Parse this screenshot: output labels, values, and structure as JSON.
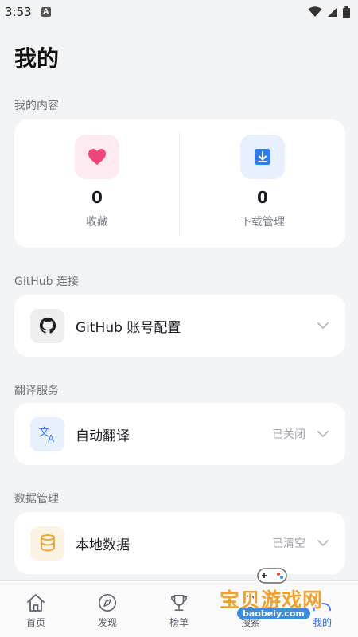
{
  "status_bar": {
    "time": "3:53",
    "notification_icon": "a-icon",
    "wifi_icon": "wifi-icon",
    "signal_icon": "signal-icon",
    "battery_icon": "battery-icon"
  },
  "header": {
    "title": "我的"
  },
  "my_content": {
    "section_label": "我的内容",
    "favorites": {
      "count": "0",
      "label": "收藏",
      "icon": "heart-icon",
      "accent": "#f0457a"
    },
    "downloads": {
      "count": "0",
      "label": "下载管理",
      "icon": "download-icon",
      "accent": "#2f7cf0"
    }
  },
  "github": {
    "section_label": "GitHub 连接",
    "row_title": "GitHub 账号配置",
    "icon": "github-icon"
  },
  "translation": {
    "section_label": "翻译服务",
    "row_title": "自动翻译",
    "status": "已关闭",
    "icon": "translate-icon"
  },
  "data_management": {
    "section_label": "数据管理",
    "row_title": "本地数据",
    "status": "已清空",
    "icon": "database-icon"
  },
  "bottom_nav": {
    "items": [
      {
        "label": "首页",
        "icon": "home-icon"
      },
      {
        "label": "发现",
        "icon": "compass-icon"
      },
      {
        "label": "榜单",
        "icon": "trophy-icon"
      },
      {
        "label": "搜索",
        "icon": "search-icon"
      },
      {
        "label": "我的",
        "icon": "profile-icon",
        "active": true
      }
    ],
    "active_color": "#2f6bf2"
  },
  "watermark": {
    "text": "宝贝游戏网",
    "url": "baobeiy.com"
  }
}
